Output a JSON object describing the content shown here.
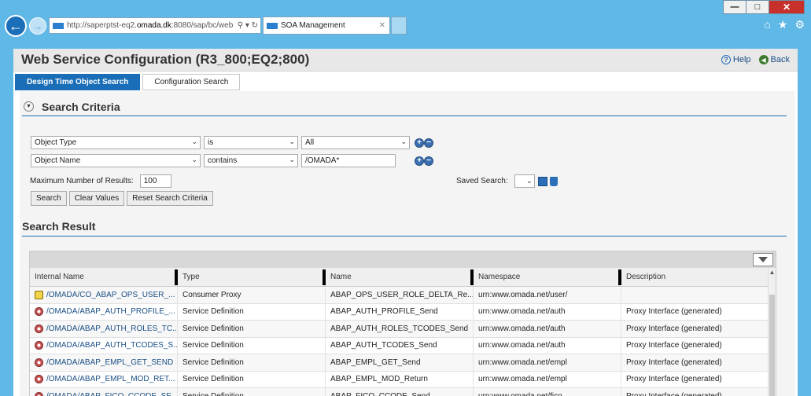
{
  "browser": {
    "url_prefix": "http://saperptst-eq2.",
    "url_host": "omada.dk",
    "url_suffix": ":8080/sap/bc/web",
    "tab_title": "SOA Management"
  },
  "page": {
    "title": "Web Service Configuration (R3_800;EQ2;800)",
    "help_label": "Help",
    "back_label": "Back"
  },
  "tabs": [
    {
      "label": "Design Time Object Search"
    },
    {
      "label": "Configuration Search"
    }
  ],
  "search": {
    "section_title": "Search Criteria",
    "rows": [
      {
        "attribute": "Object Type",
        "operator": "is",
        "value": "All"
      },
      {
        "attribute": "Object Name",
        "operator": "contains",
        "value": "/OMADA*"
      }
    ],
    "max_results_label": "Maximum Number of Results:",
    "max_results_value": "100",
    "saved_search_label": "Saved Search:",
    "buttons": {
      "search": "Search",
      "clear": "Clear Values",
      "reset": "Reset Search Criteria"
    }
  },
  "result": {
    "section_title": "Search Result",
    "columns": [
      "Internal Name",
      "Type",
      "Name",
      "Namespace",
      "Description"
    ],
    "rows": [
      {
        "icon": "proxy",
        "internal": "/OMADA/CO_ABAP_OPS_USER_...",
        "type": "Consumer Proxy",
        "name": "ABAP_OPS_USER_ROLE_DELTA_Re...",
        "namespace": "urn:www.omada.net/user/",
        "description": ""
      },
      {
        "icon": "service",
        "internal": "/OMADA/ABAP_AUTH_PROFILE_...",
        "type": "Service Definition",
        "name": "ABAP_AUTH_PROFILE_Send",
        "namespace": "urn:www.omada.net/auth",
        "description": "Proxy Interface (generated)"
      },
      {
        "icon": "service",
        "internal": "/OMADA/ABAP_AUTH_ROLES_TC...",
        "type": "Service Definition",
        "name": "ABAP_AUTH_ROLES_TCODES_Send",
        "namespace": "urn:www.omada.net/auth",
        "description": "Proxy Interface (generated)"
      },
      {
        "icon": "service",
        "internal": "/OMADA/ABAP_AUTH_TCODES_S...",
        "type": "Service Definition",
        "name": "ABAP_AUTH_TCODES_Send",
        "namespace": "urn:www.omada.net/auth",
        "description": "Proxy Interface (generated)"
      },
      {
        "icon": "service",
        "internal": "/OMADA/ABAP_EMPL_GET_SEND",
        "type": "Service Definition",
        "name": "ABAP_EMPL_GET_Send",
        "namespace": "urn:www.omada.net/empl",
        "description": "Proxy Interface (generated)"
      },
      {
        "icon": "service",
        "internal": "/OMADA/ABAP_EMPL_MOD_RET...",
        "type": "Service Definition",
        "name": "ABAP_EMPL_MOD_Return",
        "namespace": "urn:www.omada.net/empl",
        "description": "Proxy Interface (generated)"
      },
      {
        "icon": "service",
        "internal": "/OMADA/ABAP_FICO_CCODE_SE...",
        "type": "Service Definition",
        "name": "ABAP_FICO_CCODE_Send",
        "namespace": "urn:www.omada.net/fico",
        "description": "Proxy Interface (generated)"
      }
    ]
  }
}
